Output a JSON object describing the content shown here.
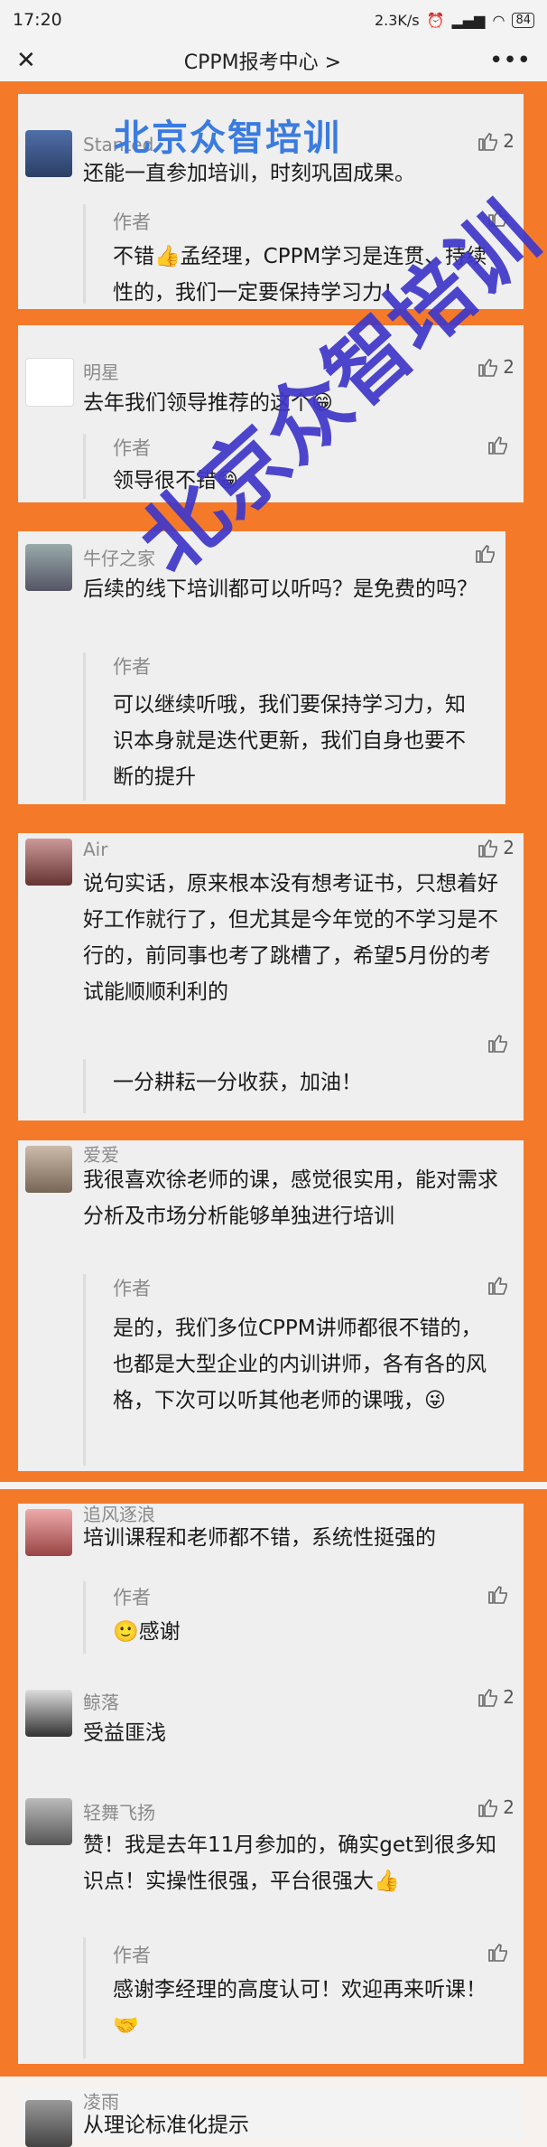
{
  "status": {
    "time": "17:20",
    "network": "2.3K/s",
    "battery": "84"
  },
  "nav": {
    "title": "CPPM报考中心 >"
  },
  "watermark": {
    "small": "北京众智培训",
    "large": "北京众智培训"
  },
  "comments": [
    {
      "name": "Stanted",
      "likes": "2",
      "text": "还能一直参加培训，时刻巩固成果。",
      "reply_author": "作者",
      "reply": "不错👍孟经理，CPPM学习是连贯、持续性的，我们一定要保持学习力！"
    },
    {
      "name": "明星",
      "likes": "2",
      "text": "去年我们领导推荐的这个😁",
      "reply_author": "作者",
      "reply": "领导很不错😁"
    },
    {
      "name": "牛仔之家",
      "likes": "",
      "text": "后续的线下培训都可以听吗？是免费的吗？",
      "reply_author": "作者",
      "reply": "可以继续听哦，我们要保持学习力，知识本身就是迭代更新，我们自身也要不断的提升"
    },
    {
      "name": "Air",
      "likes": "2",
      "text": "说句实话，原来根本没有想考证书，只想着好好工作就行了，但尤其是今年觉的不学习是不行的，前同事也考了跳槽了，希望5月份的考试能顺顺利利的",
      "reply_author": "",
      "reply": "一分耕耘一分收获，加油！"
    },
    {
      "name": "爱爱",
      "likes": "",
      "text": "我很喜欢徐老师的课，感觉很实用，能对需求分析及市场分析能够单独进行培训",
      "reply_author": "作者",
      "reply": "是的，我们多位CPPM讲师都很不错的，也都是大型企业的内训讲师，各有各的风格，下次可以听其他老师的课哦，😜"
    },
    {
      "name": "追风逐浪",
      "likes": "",
      "text": "培训课程和老师都不错，系统性挺强的",
      "reply_author": "作者",
      "reply": "🙂感谢"
    },
    {
      "name": "鲸落",
      "likes": "2",
      "text": "受益匪浅",
      "reply_author": "",
      "reply": ""
    },
    {
      "name": "轻舞飞扬",
      "likes": "2",
      "text": "赞！我是去年11月参加的，确实get到很多知识点！实操性很强，平台很强大👍",
      "reply_author": "作者",
      "reply": "感谢李经理的高度认可！欢迎再来听课！🤝"
    },
    {
      "name": "凌雨",
      "likes": "",
      "text": "从理论标准化提示",
      "reply_author": "",
      "reply": ""
    }
  ]
}
